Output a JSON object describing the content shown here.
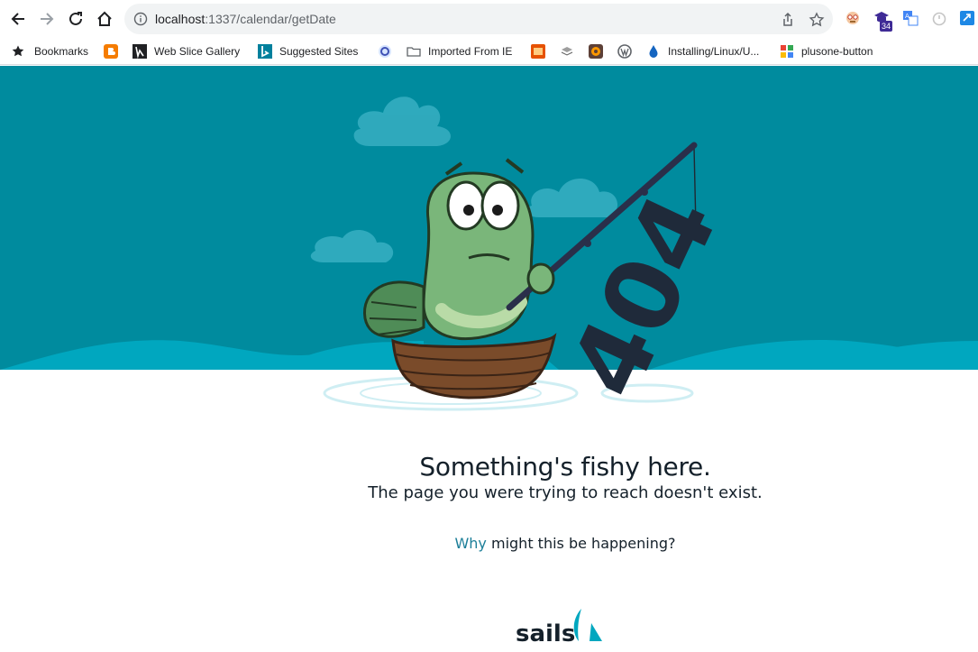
{
  "browser": {
    "url_host": "localhost",
    "url_path": ":1337/calendar/getDate",
    "extension_badge": "34"
  },
  "bookmarks": [
    {
      "label": "Bookmarks",
      "icon": "star-icon"
    },
    {
      "label": "",
      "icon": "blogger-icon"
    },
    {
      "label": "Web Slice Gallery",
      "icon": "web-slice-icon"
    },
    {
      "label": "Suggested Sites",
      "icon": "bing-icon"
    },
    {
      "label": "",
      "icon": "app-icon"
    },
    {
      "label": "Imported From IE",
      "icon": "folder-icon"
    },
    {
      "label": "",
      "icon": "bookmark-icon"
    },
    {
      "label": "",
      "icon": "stack-icon"
    },
    {
      "label": "",
      "icon": "cookie-icon"
    },
    {
      "label": "",
      "icon": "wordpress-icon"
    },
    {
      "label": "Installing/Linux/U...",
      "icon": "drop-icon"
    },
    {
      "label": "plusone-button",
      "icon": "plusone-icon"
    }
  ],
  "page": {
    "illustration_text": "404",
    "headline": "Something's fishy here.",
    "subline": "The page you were trying to reach doesn't exist.",
    "why_link": "Why",
    "why_rest": " might this be happening?",
    "logo_text": "sails"
  },
  "colors": {
    "sea": "#008b9e",
    "wave": "#00a7bf",
    "link": "#1d7f99",
    "text": "#14202a"
  }
}
